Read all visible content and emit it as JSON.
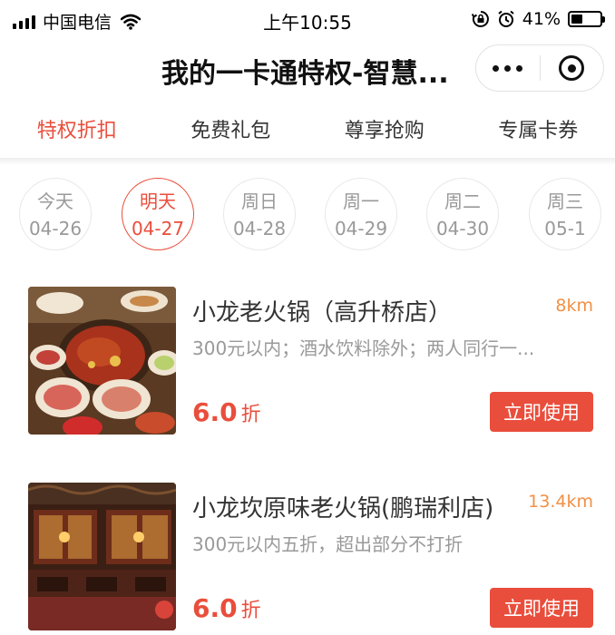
{
  "status_bar": {
    "carrier": "中国电信",
    "time": "上午10:55",
    "battery": "41%",
    "battery_level": 0.41
  },
  "nav": {
    "title": "我的一卡通特权-智慧..."
  },
  "tabs": [
    {
      "label": "特权折扣",
      "active": true
    },
    {
      "label": "免费礼包",
      "active": false
    },
    {
      "label": "尊享抢购",
      "active": false
    },
    {
      "label": "专属卡券",
      "active": false
    }
  ],
  "dates": [
    {
      "day": "今天",
      "date": "04-26",
      "active": false
    },
    {
      "day": "明天",
      "date": "04-27",
      "active": true
    },
    {
      "day": "周日",
      "date": "04-28",
      "active": false
    },
    {
      "day": "周一",
      "date": "04-29",
      "active": false
    },
    {
      "day": "周二",
      "date": "04-30",
      "active": false
    },
    {
      "day": "周三",
      "date": "05-1",
      "active": false
    }
  ],
  "items": [
    {
      "name": "小龙老火锅（高升桥店）",
      "distance": "8km",
      "desc": "300元以内；酒水饮料除外；两人同行一...",
      "discount": "6.0",
      "discount_unit": "折",
      "button": "立即使用"
    },
    {
      "name": "小龙坎原味老火锅(鹏瑞利店)",
      "distance": "13.4km",
      "desc": "300元以内五折，超出部分不打折",
      "discount": "6.0",
      "discount_unit": "折",
      "button": "立即使用"
    }
  ],
  "colors": {
    "accent": "#e94e3c",
    "distance": "#f29046",
    "muted": "#999999"
  }
}
